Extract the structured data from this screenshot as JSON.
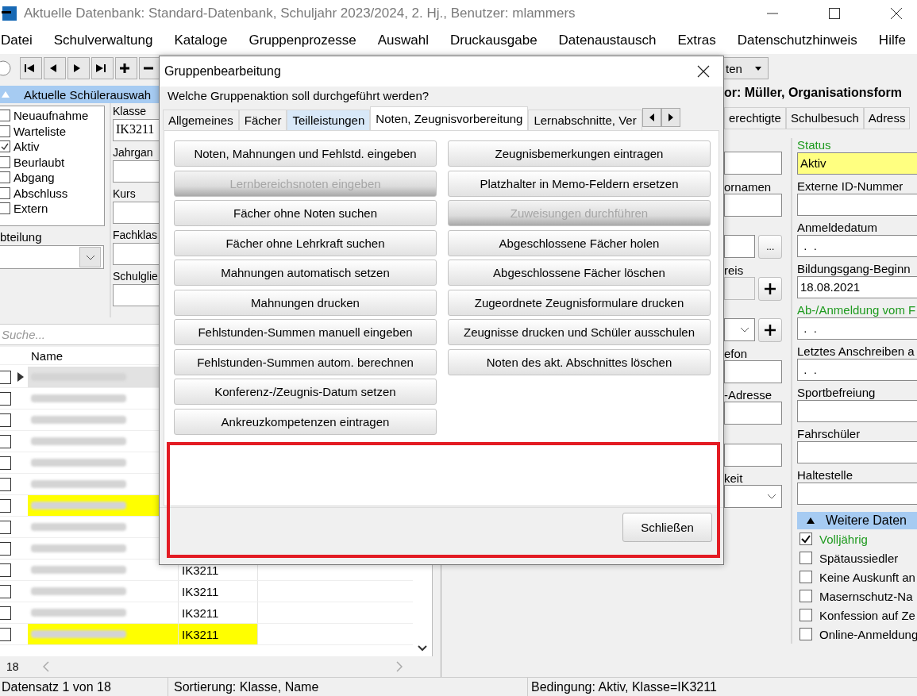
{
  "window": {
    "title": "Aktuelle Datenbank: Standard-Datenbank, Schuljahr 2023/2024, 2. Hj., Benutzer: mlammers"
  },
  "menu": [
    "Datei",
    "Schulverwaltung",
    "Kataloge",
    "Gruppenprozesse",
    "Auswahl",
    "Druckausgabe",
    "Datenaustausch",
    "Extras",
    "Datenschutzhinweis",
    "Hilfe"
  ],
  "toolbar": {
    "dropdown": "ten"
  },
  "left_panel": {
    "header": "Aktuelle Schülerauswah",
    "expanded": true,
    "filters": [
      {
        "label": "Neuaufnahme",
        "checked": false
      },
      {
        "label": "Warteliste",
        "checked": false
      },
      {
        "label": "Aktiv",
        "checked": true
      },
      {
        "label": "Beurlaubt",
        "checked": false
      },
      {
        "label": "Abgang",
        "checked": false
      },
      {
        "label": "Abschluss",
        "checked": false
      },
      {
        "label": "Extern",
        "checked": false
      }
    ],
    "fields": [
      {
        "label": "Klasse",
        "value": "IK3211"
      },
      {
        "label": "Jahrgan"
      },
      {
        "label": "Kurs"
      },
      {
        "label": "Fachklas"
      },
      {
        "label": "Schulglie"
      }
    ],
    "abteilung_label": "bteilung",
    "search": {
      "placeholder": "Suche..."
    }
  },
  "table": {
    "columns": [
      "Name"
    ],
    "count": "18",
    "rows": [
      {
        "selected": true,
        "highlighted": false,
        "checked": false
      },
      {
        "selected": false,
        "highlighted": false,
        "checked": false
      },
      {
        "selected": false,
        "highlighted": false,
        "checked": false
      },
      {
        "selected": false,
        "highlighted": false,
        "checked": false
      },
      {
        "selected": false,
        "highlighted": false,
        "checked": false
      },
      {
        "selected": false,
        "highlighted": false,
        "checked": false
      },
      {
        "selected": false,
        "highlighted": true,
        "checked": false
      },
      {
        "selected": false,
        "highlighted": false,
        "checked": false
      },
      {
        "selected": false,
        "highlighted": false,
        "checked": false
      },
      {
        "selected": false,
        "highlighted": false,
        "checked": false,
        "klasse": "IK3211"
      },
      {
        "selected": false,
        "highlighted": false,
        "checked": false,
        "klasse": "IK3211"
      },
      {
        "selected": false,
        "highlighted": false,
        "checked": false,
        "klasse": "IK3211"
      },
      {
        "selected": false,
        "highlighted": true,
        "checked": false,
        "klasse": "IK3211"
      }
    ]
  },
  "record": {
    "header": "or: Müller, Organisationsform",
    "tabs": [
      "erechtigte",
      "Schulbesuch",
      "Adress"
    ],
    "mid_fields": [
      {
        "kind": "input"
      },
      {
        "kind": "input",
        "label": "ornamen"
      },
      {
        "kind": "input_button",
        "button": "..."
      },
      {
        "kind": "input_plus",
        "label": "reis",
        "disabled": true
      },
      {
        "kind": "dropdown_plus"
      },
      {
        "kind": "input",
        "label": "efon"
      },
      {
        "kind": "input",
        "label": "-Adresse"
      },
      {
        "kind": "input"
      },
      {
        "kind": "dropdown",
        "label": "keit"
      }
    ],
    "right_fields": [
      {
        "label": "Status",
        "value": "Aktiv",
        "color": "#1e9a1e",
        "highlighted": true
      },
      {
        "label": "Externe ID-Nummer",
        "color": "#000000",
        "highlighted": false
      },
      {
        "label": "Anmeldedatum",
        "value": " .  .",
        "color": "#000000",
        "highlighted": false
      },
      {
        "label": "Bildungsgang-Beginn",
        "value": "18.08.2021",
        "color": "#000000",
        "highlighted": false
      },
      {
        "label": "Ab-/Anmeldung vom F",
        "value": " .  .",
        "color": "#1e9a1e",
        "highlighted": false
      },
      {
        "label": "Letztes Anschreiben a",
        "value": " .  .",
        "color": "#000000",
        "highlighted": false
      },
      {
        "label": "Sportbefreiung",
        "color": "#000000",
        "highlighted": false
      },
      {
        "label": "Fahrschüler",
        "color": "#000000",
        "highlighted": false
      },
      {
        "label": "Haltestelle",
        "color": "#000000",
        "highlighted": false
      }
    ],
    "more": {
      "header": "Weitere Daten",
      "expanded": true,
      "items": [
        {
          "label": "Volljährig",
          "checked": true,
          "color": "#1e9a1e"
        },
        {
          "label": "Spätaussiedler",
          "checked": false,
          "color": "#000000"
        },
        {
          "label": "Keine Auskunft an",
          "checked": false,
          "color": "#000000"
        },
        {
          "label": "Masernschutz-Na",
          "checked": false,
          "color": "#000000"
        },
        {
          "label": "Konfession auf Ze",
          "checked": false,
          "color": "#000000"
        },
        {
          "label": "Online-Anmeldung",
          "checked": false,
          "color": "#000000"
        }
      ]
    }
  },
  "dialog": {
    "title": "Gruppenbearbeitung",
    "question": "Welche Gruppenaktion soll durchgeführt werden?",
    "tabs": [
      {
        "label": "Allgemeines",
        "selected": false,
        "hovered": false
      },
      {
        "label": "Fächer",
        "selected": false,
        "hovered": false
      },
      {
        "label": "Teilleistungen",
        "selected": false,
        "hovered": true
      },
      {
        "label": "Noten, Zeugnisvorbereitung",
        "selected": true,
        "hovered": false
      },
      {
        "label": "Lernabschnitte, Ver",
        "selected": false,
        "hovered": false
      }
    ],
    "left_buttons": [
      {
        "label": "Noten, Mahnungen und Fehlstd. eingeben",
        "disabled": false
      },
      {
        "label": "Lernbereichsnoten eingeben",
        "disabled": true
      },
      {
        "label": "Fächer ohne Noten suchen",
        "disabled": false
      },
      {
        "label": "Fächer ohne Lehrkraft suchen",
        "disabled": false
      },
      {
        "label": "Mahnungen automatisch setzen",
        "disabled": false
      },
      {
        "label": "Mahnungen drucken",
        "disabled": false
      },
      {
        "label": "Fehlstunden-Summen manuell eingeben",
        "disabled": false
      },
      {
        "label": "Fehlstunden-Summen autom. berechnen",
        "disabled": false
      },
      {
        "label": "Konferenz-/Zeugnis-Datum setzen",
        "disabled": false
      },
      {
        "label": "Ankreuzkompetenzen eintragen",
        "disabled": false
      }
    ],
    "right_buttons": [
      {
        "label": "Zeugnisbemerkungen eintragen",
        "disabled": false
      },
      {
        "label": "Platzhalter in Memo-Feldern ersetzen",
        "disabled": false
      },
      {
        "label": "Zuweisungen durchführen",
        "disabled": true
      },
      {
        "label": "Abgeschlossene Fächer holen",
        "disabled": false
      },
      {
        "label": "Abgeschlossene Fächer löschen",
        "disabled": false
      },
      {
        "label": "Zugeordnete Zeugnisformulare drucken",
        "disabled": false
      },
      {
        "label": "Zeugnisse drucken und Schüler ausschulen",
        "disabled": false
      },
      {
        "label": "Noten des akt. Abschnittes löschen",
        "disabled": false
      }
    ],
    "close_button": "Schließen"
  },
  "status_bar": [
    "Datensatz 1 von 18",
    "Sortierung: Klasse, Name",
    "Bedingung: Aktiv, Klasse=IK3211"
  ]
}
